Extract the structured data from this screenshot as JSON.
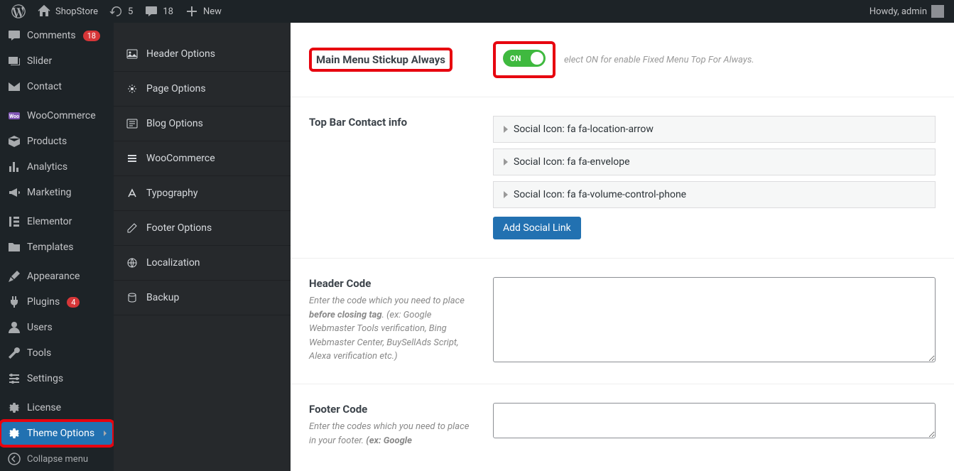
{
  "adminbar": {
    "site_name": "ShopStore",
    "updates": "5",
    "comments": "18",
    "new_label": "New",
    "howdy": "Howdy, admin"
  },
  "adminmenu": {
    "comments": {
      "label": "Comments",
      "badge": "18"
    },
    "slider": {
      "label": "Slider"
    },
    "contact": {
      "label": "Contact"
    },
    "woocommerce": {
      "label": "WooCommerce"
    },
    "products": {
      "label": "Products"
    },
    "analytics": {
      "label": "Analytics"
    },
    "marketing": {
      "label": "Marketing"
    },
    "elementor": {
      "label": "Elementor"
    },
    "templates": {
      "label": "Templates"
    },
    "appearance": {
      "label": "Appearance"
    },
    "plugins": {
      "label": "Plugins",
      "badge": "4"
    },
    "users": {
      "label": "Users"
    },
    "tools": {
      "label": "Tools"
    },
    "settings": {
      "label": "Settings"
    },
    "license": {
      "label": "License"
    },
    "theme_options": {
      "label": "Theme Options"
    },
    "collapse": {
      "label": "Collapse menu"
    }
  },
  "options_tabs": {
    "header": "Header Options",
    "page": "Page Options",
    "blog": "Blog Options",
    "woocommerce": "WooCommerce",
    "typography": "Typography",
    "footer": "Footer Options",
    "localization": "Localization",
    "backup": "Backup"
  },
  "main": {
    "stickup": {
      "label": "Main Menu Stickup Always",
      "toggle": "ON",
      "helper": "elect ON for enable Fixed Menu Top For Always."
    },
    "topbar": {
      "label": "Top Bar Contact info",
      "items": [
        "Social Icon: fa fa-location-arrow",
        "Social Icon: fa fa-envelope",
        "Social Icon: fa fa-volume-control-phone"
      ],
      "add_btn": "Add Social Link"
    },
    "header_code": {
      "label": "Header Code",
      "desc_pre": "Enter the code which you need to place ",
      "desc_strong": "before closing tag",
      "desc_post": ". (ex: Google Webmaster Tools verification, Bing Webmaster Center, BuySellAds Script, Alexa verification etc.)",
      "value": ""
    },
    "footer_code": {
      "label": "Footer Code",
      "desc_pre": "Enter the codes which you need to place in your footer. ",
      "desc_strong": "(ex: Google",
      "value": ""
    }
  }
}
